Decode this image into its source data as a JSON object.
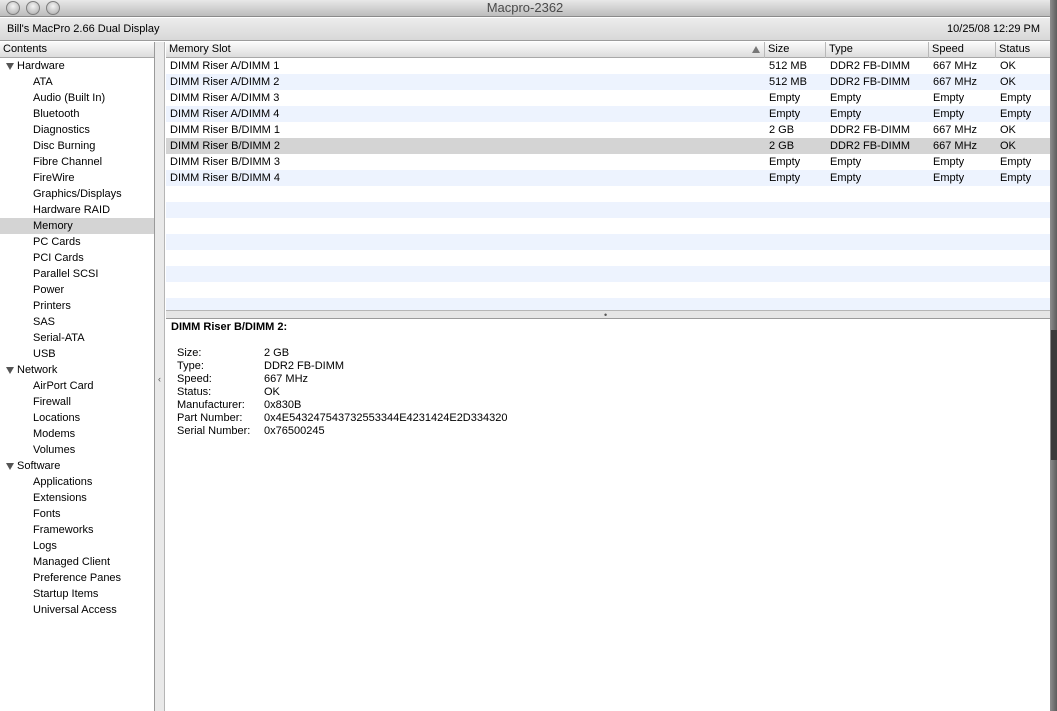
{
  "window": {
    "title": "Macpro-2362"
  },
  "info": {
    "machine": "Bill's MacPro 2.66 Dual Display",
    "datetime": "10/25/08 12:29 PM"
  },
  "sidebar": {
    "header": "Contents",
    "groups": [
      {
        "label": "Hardware",
        "items": [
          "ATA",
          "Audio (Built In)",
          "Bluetooth",
          "Diagnostics",
          "Disc Burning",
          "Fibre Channel",
          "FireWire",
          "Graphics/Displays",
          "Hardware RAID",
          "Memory",
          "PC Cards",
          "PCI Cards",
          "Parallel SCSI",
          "Power",
          "Printers",
          "SAS",
          "Serial-ATA",
          "USB"
        ]
      },
      {
        "label": "Network",
        "items": [
          "AirPort Card",
          "Firewall",
          "Locations",
          "Modems",
          "Volumes"
        ]
      },
      {
        "label": "Software",
        "items": [
          "Applications",
          "Extensions",
          "Fonts",
          "Frameworks",
          "Logs",
          "Managed Client",
          "Preference Panes",
          "Startup Items",
          "Universal Access"
        ]
      }
    ],
    "selected": "Memory"
  },
  "table": {
    "columns": [
      "Memory Slot",
      "Size",
      "Type",
      "Speed",
      "Status"
    ],
    "rows": [
      [
        "DIMM Riser A/DIMM 1",
        "512 MB",
        "DDR2 FB-DIMM",
        "667 MHz",
        "OK"
      ],
      [
        "DIMM Riser A/DIMM 2",
        "512 MB",
        "DDR2 FB-DIMM",
        "667 MHz",
        "OK"
      ],
      [
        "DIMM Riser A/DIMM 3",
        "Empty",
        "Empty",
        "Empty",
        "Empty"
      ],
      [
        "DIMM Riser A/DIMM 4",
        "Empty",
        "Empty",
        "Empty",
        "Empty"
      ],
      [
        "DIMM Riser B/DIMM 1",
        "2 GB",
        "DDR2 FB-DIMM",
        "667 MHz",
        "OK"
      ],
      [
        "DIMM Riser B/DIMM 2",
        "2 GB",
        "DDR2 FB-DIMM",
        "667 MHz",
        "OK"
      ],
      [
        "DIMM Riser B/DIMM 3",
        "Empty",
        "Empty",
        "Empty",
        "Empty"
      ],
      [
        "DIMM Riser B/DIMM 4",
        "Empty",
        "Empty",
        "Empty",
        "Empty"
      ]
    ],
    "selected_row": 5
  },
  "detail": {
    "title": "DIMM Riser B/DIMM 2:",
    "fields": [
      {
        "key": "Size:",
        "value": "2 GB"
      },
      {
        "key": "Type:",
        "value": "DDR2 FB-DIMM"
      },
      {
        "key": "Speed:",
        "value": "667 MHz"
      },
      {
        "key": "Status:",
        "value": "OK"
      },
      {
        "key": "Manufacturer:",
        "value": "0x830B"
      },
      {
        "key": "Part Number:",
        "value": "0x4E543247543732553344E4231424E2D334320"
      },
      {
        "key": "Serial Number:",
        "value": "0x76500245"
      }
    ]
  },
  "icons": {
    "sort": "sort-ascending-icon",
    "disclosure": "disclosure-triangle-icon"
  }
}
